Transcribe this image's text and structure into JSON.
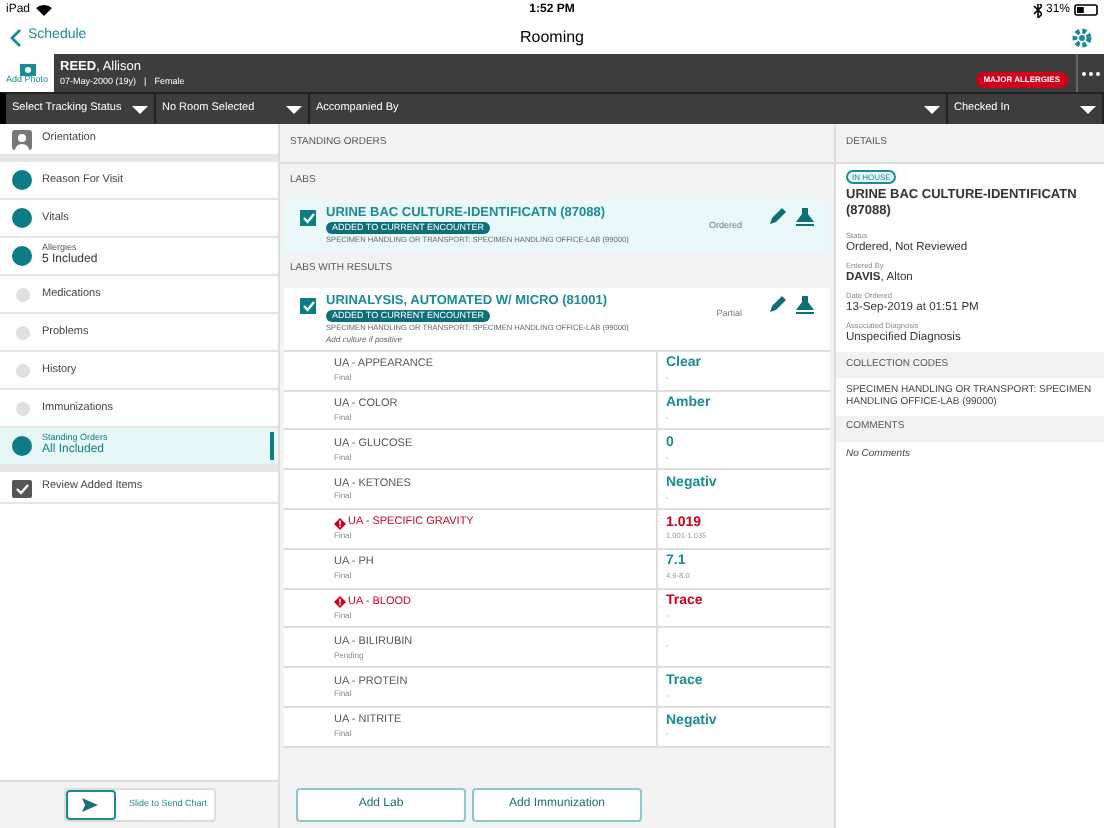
{
  "status_bar": {
    "device": "iPad",
    "time": "1:52 PM",
    "battery": "31%"
  },
  "nav": {
    "back": "Schedule",
    "title": "Rooming"
  },
  "patient": {
    "add_photo": "Add Photo",
    "name": "**REED**, Allison",
    "dob": "07-May-2000 (19y)",
    "separator": "|",
    "sex": "Female",
    "alert": "MAJOR ALLERGIES"
  },
  "dropdowns": [
    "Select Tracking Status",
    "No Room Selected",
    "Accompanied By",
    "Checked In"
  ],
  "sidebar": {
    "items": [
      {
        "kind": "orientation",
        "label": "Orientation",
        "selected": false
      },
      {
        "kind": "step",
        "label": "Reason For Visit",
        "done": true,
        "selected": false
      },
      {
        "kind": "step",
        "label": "Vitals",
        "done": true,
        "selected": false
      },
      {
        "kind": "step",
        "label": "Allergies",
        "sublabel": "5 Included",
        "done": true,
        "selected": false
      },
      {
        "kind": "step",
        "label": "Medications",
        "done": false,
        "selected": false
      },
      {
        "kind": "step",
        "label": "Problems",
        "done": false,
        "selected": false
      },
      {
        "kind": "step",
        "label": "History",
        "done": false,
        "selected": false
      },
      {
        "kind": "step",
        "label": "Immunizations",
        "done": false,
        "selected": false
      },
      {
        "kind": "step",
        "label": "Standing Orders",
        "sublabel": "All Included",
        "done": true,
        "selected": true
      },
      {
        "kind": "review",
        "label": "Review Added Items",
        "selected": false
      }
    ],
    "send": {
      "label": "Slide to Send Chart",
      "level": 0
    }
  },
  "orders": {
    "title": "STANDING ORDERS",
    "sections": [
      {
        "title": "LABS",
        "order": {
          "name": "URINE BAC CULTURE-IDENTIFICATN (87088)",
          "tag": "ADDED TO CURRENT ENCOUNTER",
          "codes": "SPECIMEN HANDLING OR TRANSPORT: SPECIMEN HANDLING OFFICE-LAB (99000)",
          "state": "Ordered",
          "checked": true,
          "selected": true
        }
      },
      {
        "title": "LABS WITH RESULTS",
        "order": {
          "name": "URINALYSIS, AUTOMATED W/ MICRO (81001)",
          "tag": "ADDED TO CURRENT ENCOUNTER",
          "codes": "SPECIMEN HANDLING OR TRANSPORT: SPECIMEN HANDLING OFFICE-LAB (99000)",
          "note": "Add culture if positive",
          "state": "Partial",
          "checked": true,
          "selected": false
        },
        "results": [
          {
            "name": "UA - APPEARANCE",
            "status": "Final",
            "value": "Clear",
            "range": "-",
            "abnormal": false
          },
          {
            "name": "UA - COLOR",
            "status": "Final",
            "value": "Amber",
            "range": "-",
            "abnormal": false
          },
          {
            "name": "UA - GLUCOSE",
            "status": "Final",
            "value": "0",
            "range": "-",
            "abnormal": false
          },
          {
            "name": "UA - KETONES",
            "status": "Final",
            "value": "Negativ",
            "range": "-",
            "abnormal": false
          },
          {
            "name": "UA - SPECIFIC GRAVITY",
            "status": "Final",
            "value": "1.019",
            "range": "1.001-1.035",
            "abnormal": true
          },
          {
            "name": "UA - PH",
            "status": "Final",
            "value": "7.1",
            "range": "4.6-8.0",
            "abnormal": false
          },
          {
            "name": "UA - BLOOD",
            "status": "Final",
            "value": "Trace",
            "range": "-",
            "abnormal": true
          },
          {
            "name": "UA - BILIRUBIN",
            "status": "Pending",
            "range": "-",
            "abnormal": false
          },
          {
            "name": "UA - PROTEIN",
            "status": "Final",
            "value": "Trace",
            "range": "-",
            "abnormal": false
          },
          {
            "name": "UA - NITRITE",
            "status": "Final",
            "value": "Negativ",
            "range": "-",
            "abnormal": false
          }
        ]
      }
    ],
    "buttons": [
      "Add Lab",
      "Add Immunization"
    ]
  },
  "details": {
    "title": "DETAILS",
    "badge": "IN HOUSE",
    "name": "URINE BAC CULTURE-IDENTIFICATN (87088)",
    "fields": [
      {
        "label": "Status",
        "value": "Ordered, Not Reviewed"
      },
      {
        "label": "Entered By",
        "value": "**DAVIS**, Alton"
      },
      {
        "label": "Date Ordered",
        "value": "13-Sep-2019 at 01:51 PM"
      },
      {
        "label": "Associated Diagnosis",
        "value": "Unspecified Diagnosis"
      }
    ],
    "collection_title": "COLLECTION CODES",
    "collection": "SPECIMEN HANDLING OR TRANSPORT: SPECIMEN HANDLING OFFICE-LAB (99000)",
    "comments_title": "COMMENTS",
    "comments": "No Comments"
  }
}
